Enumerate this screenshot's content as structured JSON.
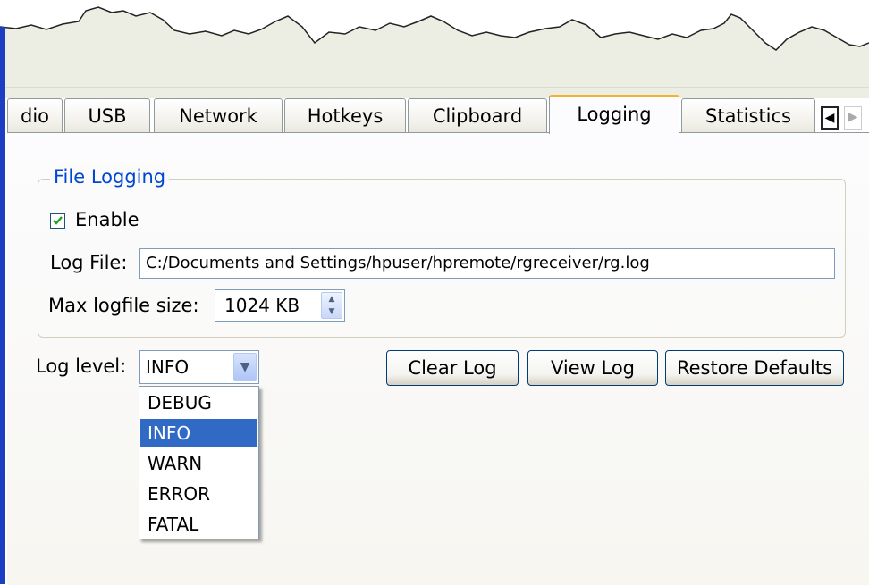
{
  "tabs": [
    {
      "label": "dio",
      "active": false
    },
    {
      "label": "USB",
      "active": false
    },
    {
      "label": "Network",
      "active": false
    },
    {
      "label": "Hotkeys",
      "active": false
    },
    {
      "label": "Clipboard",
      "active": false
    },
    {
      "label": "Logging",
      "active": true
    },
    {
      "label": "Statistics",
      "active": false
    }
  ],
  "file_logging": {
    "group_title": "File Logging",
    "enable_label": "Enable",
    "enable_checked": true,
    "log_file_label": "Log File:",
    "log_file_value": "C:/Documents and Settings/hpuser/hpremote/rgreceiver/rg.log",
    "max_size_label": "Max logfile size:",
    "max_size_value": "1024 KB"
  },
  "log_level": {
    "label": "Log level:",
    "selected": "INFO",
    "options": [
      "DEBUG",
      "INFO",
      "WARN",
      "ERROR",
      "FATAL"
    ]
  },
  "buttons": {
    "clear_log": "Clear Log",
    "view_log": "View Log",
    "restore_defaults": "Restore Defaults"
  },
  "colors": {
    "accent_tab": "#f3b132",
    "selection": "#316ac5",
    "group_title": "#0046d5"
  }
}
